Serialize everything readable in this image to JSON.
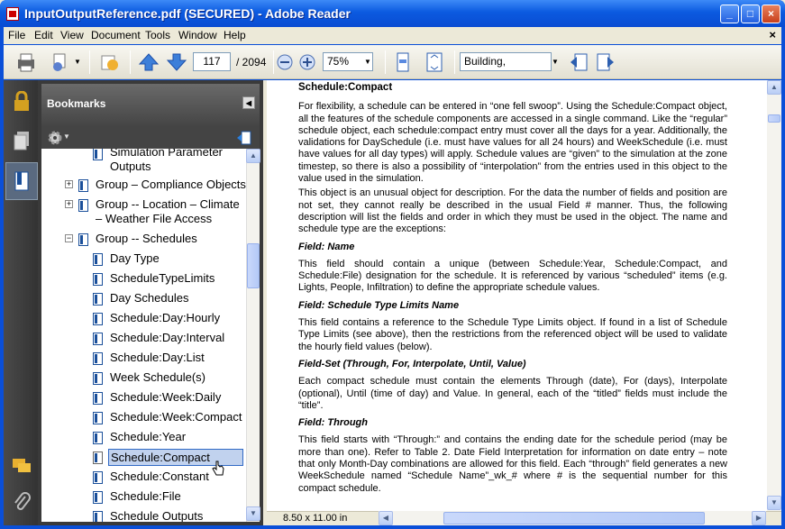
{
  "window": {
    "title": "InputOutputReference.pdf (SECURED) - Adobe Reader"
  },
  "menu": [
    "File",
    "Edit",
    "View",
    "Document",
    "Tools",
    "Window",
    "Help"
  ],
  "toolbar": {
    "page_current": "117",
    "page_total": "/ 2094",
    "zoom": "75%",
    "search": "Building,"
  },
  "bookmarks": {
    "title": "Bookmarks",
    "items": [
      "Simulation Parameter",
      "Outputs",
      "Group – Compliance Objects",
      "Group -- Location – Climate",
      "– Weather File Access",
      "Group -- Schedules",
      "Day Type",
      "ScheduleTypeLimits",
      "Day Schedules",
      "Schedule:Day:Hourly",
      "Schedule:Day:Interval",
      "Schedule:Day:List",
      "Week Schedule(s)",
      "Schedule:Week:Daily",
      "Schedule:Week:Compact",
      "Schedule:Year",
      "Schedule:Compact",
      "Schedule:Constant",
      "Schedule:File",
      "Schedule Outputs"
    ]
  },
  "document": {
    "heading": "Schedule:Compact",
    "p1": "For flexibility, a schedule can be entered in “one fell swoop”. Using the Schedule:Compact object, all the features of the schedule components are accessed in a single command. Like the “regular” schedule object, each schedule:compact entry must cover all the days for a year. Additionally, the validations for DaySchedule (i.e. must have values for all 24 hours) and WeekSchedule (i.e. must have values for all day types) will apply. Schedule values are “given” to the simulation at the zone timestep, so there is also a possibility of “interpolation” from the entries used in this object to the value used in the simulation.",
    "p2": "This object is an unusual object for description. For the data the number of fields and position are not set, they cannot really be described in the usual Field # manner. Thus, the following description will list the fields and order in which they must be used in the object. The name and schedule type are the exceptions:",
    "f1": "Field: Name",
    "p3": "This field should contain a unique (between Schedule:Year, Schedule:Compact, and Schedule:File) designation for the schedule. It is referenced by various “scheduled” items (e.g. Lights, People, Infiltration) to define the appropriate schedule values.",
    "f2": "Field: Schedule Type Limits Name",
    "p4": "This field contains a reference to the Schedule Type Limits object. If found in a list of Schedule Type Limits (see above), then the restrictions from the referenced object will be used to validate the hourly field values (below).",
    "f3": "Field-Set (Through, For, Interpolate, Until, Value)",
    "p5": "Each compact schedule must contain the elements Through (date), For (days), Interpolate (optional), Until (time of day) and Value. In general, each of the “titled” fields must include the “title”.",
    "f4": "Field: Through",
    "p6": "This field starts with “Through:” and contains the ending date for the schedule period (may be more than one). Refer to Table 2. Date Field Interpretation for information on date entry – note that only Month-Day combinations are allowed for this field. Each “through” field generates a new WeekSchedule named “Schedule Name”_wk_# where # is the sequential number for this compact schedule."
  },
  "status": {
    "page_size": "8.50 x 11.00 in"
  }
}
